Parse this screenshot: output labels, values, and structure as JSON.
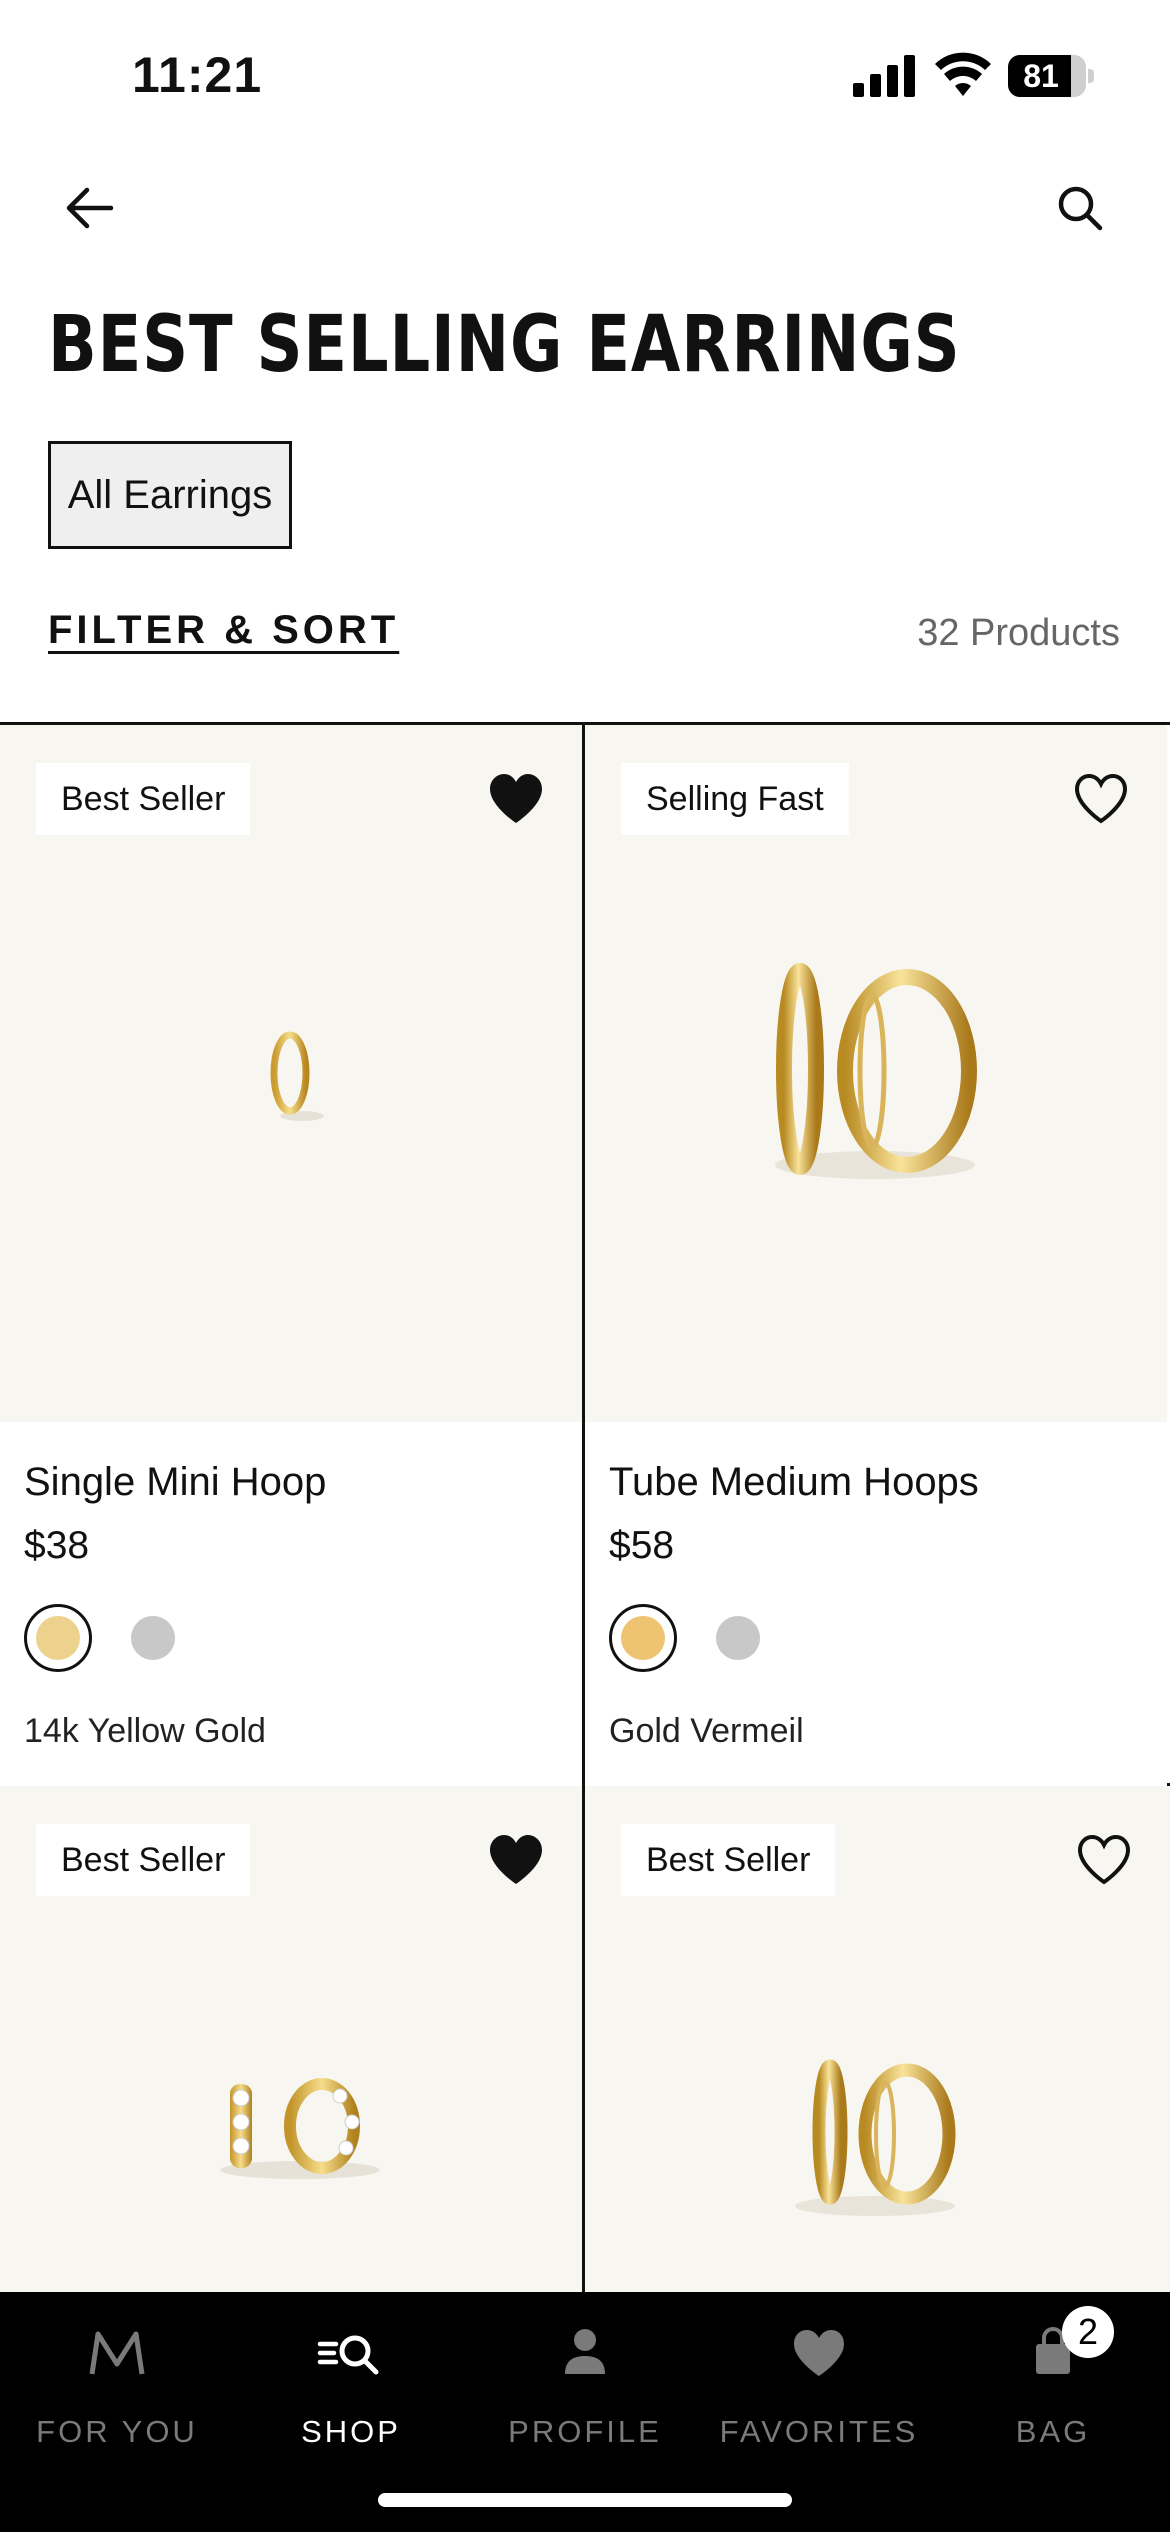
{
  "status_bar": {
    "time": "11:21",
    "battery_level": "81",
    "battery_fraction": 0.81
  },
  "header": {
    "back_icon": "arrow-left-icon",
    "search_icon": "search-icon",
    "title": "BEST SELLING EARRINGS"
  },
  "filter_chip": {
    "label": "All Earrings",
    "selected": true
  },
  "toolbar": {
    "filter_sort_label": "FILTER & SORT",
    "product_count": "32 Products"
  },
  "products": [
    {
      "badge": "Best Seller",
      "favorited": true,
      "name": "Single Mini Hoop",
      "price": "$38",
      "selected_swatch_color": "#ecd28d",
      "alt_swatch_color": "#c8c8c8",
      "variant": "14k Yellow Gold"
    },
    {
      "badge": "Selling Fast",
      "favorited": false,
      "name": "Tube Medium Hoops",
      "price": "$58",
      "selected_swatch_color": "#eec473",
      "alt_swatch_color": "#c8c8c8",
      "variant": "Gold Vermeil"
    },
    {
      "badge": "Best Seller",
      "favorited": true
    },
    {
      "badge": "Best Seller",
      "favorited": false
    }
  ],
  "tab_bar": {
    "tabs": [
      {
        "label": "FOR YOU",
        "icon": "m-logo-icon",
        "active": false
      },
      {
        "label": "SHOP",
        "icon": "shop-search-icon",
        "active": true
      },
      {
        "label": "PROFILE",
        "icon": "person-icon",
        "active": false
      },
      {
        "label": "FAVORITES",
        "icon": "heart-icon",
        "active": false
      },
      {
        "label": "BAG",
        "icon": "bag-icon",
        "active": false
      }
    ],
    "bag_count": "2"
  },
  "colors": {
    "accent": "#111111",
    "image_background": "#f8f6f0",
    "tab_bar_background": "#000000",
    "gold": "#e6c35a"
  }
}
